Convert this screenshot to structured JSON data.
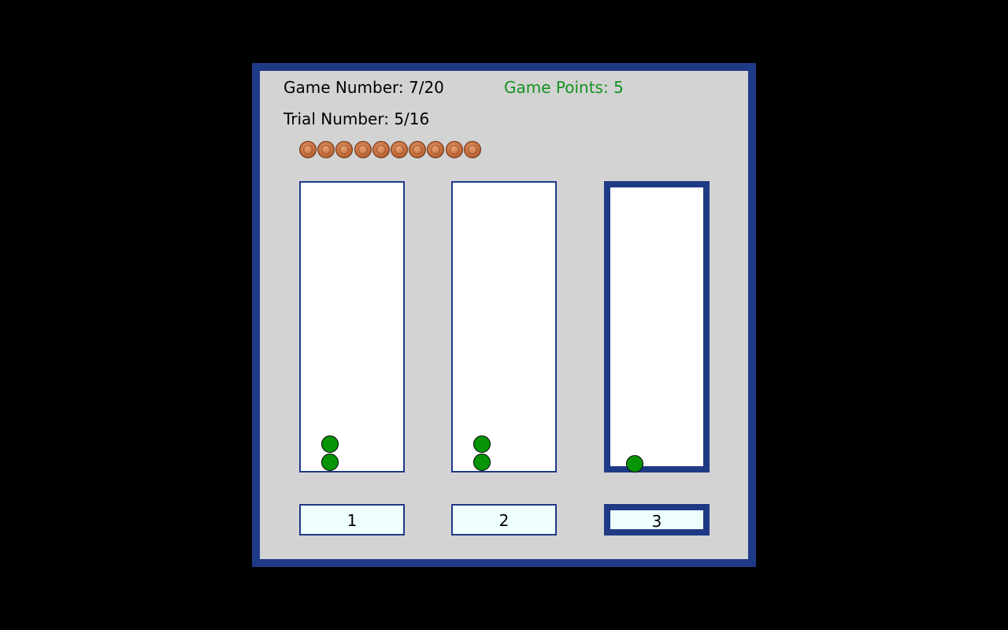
{
  "header": {
    "game_number": "Game Number: 7/20",
    "game_points": "Game Points: 5",
    "trial_number": "Trial Number: 5/16"
  },
  "coins": {
    "count": 10,
    "icon": "penny-icon"
  },
  "colors": {
    "frame": "#1f3a85",
    "panel": "#d3d3d3",
    "ball": "#079407",
    "points_text": "#14911e",
    "label_bg": "#eefffe"
  },
  "columns": [
    {
      "label": "1",
      "balls": 2,
      "selected": false
    },
    {
      "label": "2",
      "balls": 2,
      "selected": false
    },
    {
      "label": "3",
      "balls": 1,
      "selected": true
    }
  ]
}
